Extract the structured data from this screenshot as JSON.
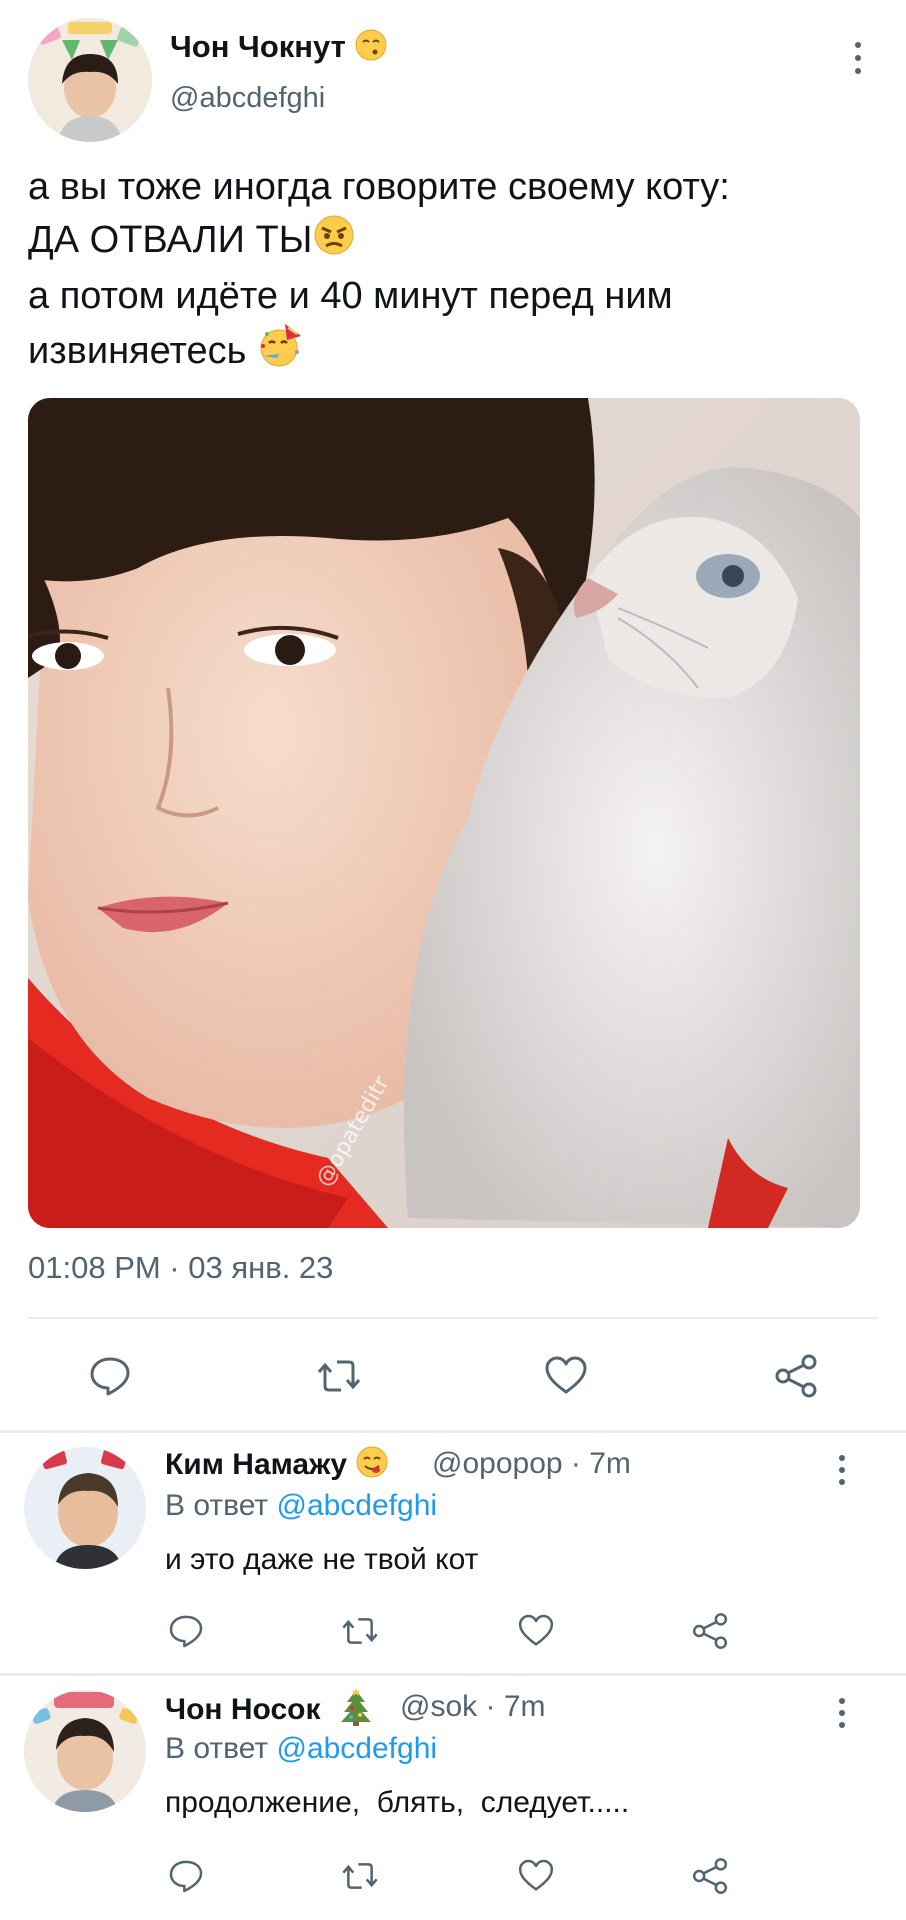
{
  "tweet": {
    "author_name": "Чон Чокнут",
    "author_emoji": "kissing-face-emoji",
    "author_handle": "@abcdefghi",
    "text_lines": [
      "а вы тоже иногда говорите своему коту:",
      "ДА ОТВАЛИ ТЫ",
      "а потом идёте и 40 минут перед ним",
      "извиняетесь"
    ],
    "text_emojis": [
      "angry-face-emoji",
      "partying-face-emoji"
    ],
    "media_watermark": "@opateditr",
    "timestamp": "01:08 PM · 03 янв. 23",
    "actions": [
      "reply-icon",
      "retweet-icon",
      "like-icon",
      "share-icon"
    ]
  },
  "replies": [
    {
      "name": "Ким Намажу",
      "emoji": "face-savoring-food-emoji",
      "handle": "@opopop",
      "time": "7m",
      "reply_prefix": "В ответ",
      "reply_mention": "@abcdefghi",
      "text": "и это даже не твой кот"
    },
    {
      "name": "Чон Носок",
      "emoji": "christmas-tree-emoji",
      "handle": "@sok",
      "time": "7m",
      "reply_prefix": "В ответ",
      "reply_mention": "@abcdefghi",
      "text": "продолжение,  блять,  следует....."
    }
  ],
  "colors": {
    "text": "#0f1419",
    "secondary": "#536471",
    "link": "#1d9bf0",
    "divider": "#e6ecf0"
  }
}
